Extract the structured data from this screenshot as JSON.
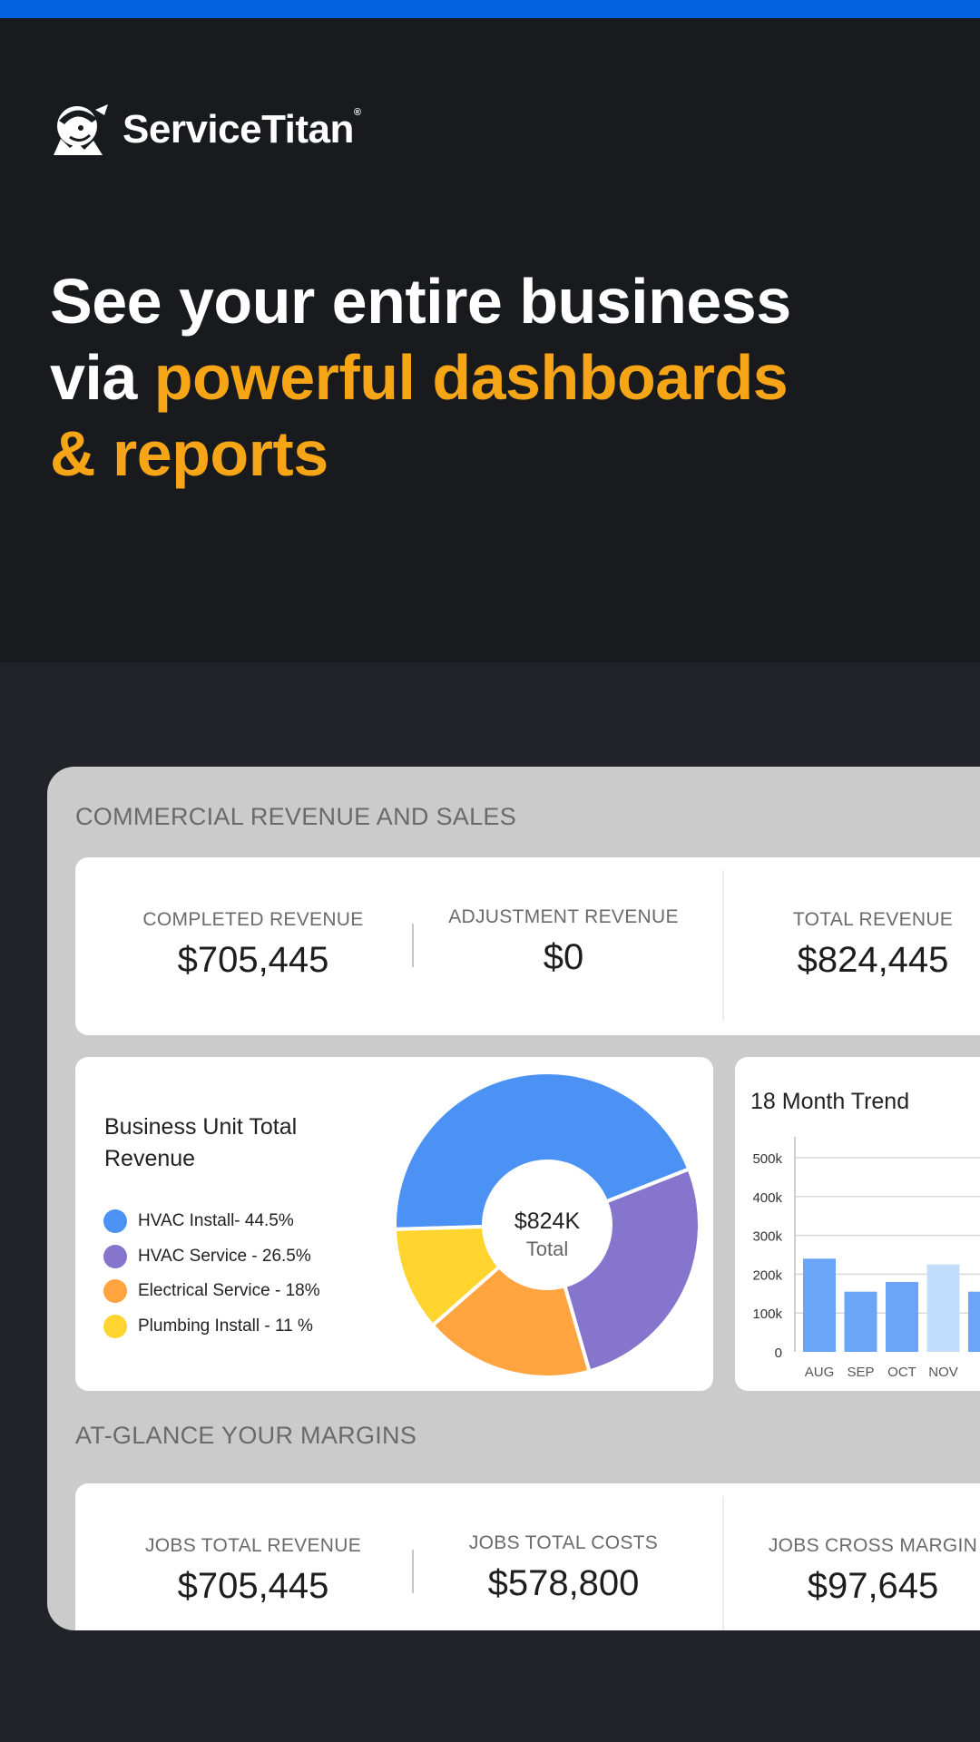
{
  "brand": {
    "name": "ServiceTitan",
    "reg_mark": "®",
    "accent_blue": "#0262e0",
    "accent_orange": "#f5a515"
  },
  "hero": {
    "line1": "See your entire business",
    "line2_prefix": "via ",
    "line2_highlight": "powerful dashboards",
    "line3_highlight": "& reports"
  },
  "revenue_section": {
    "title": "COMMERCIAL REVENUE AND SALES",
    "kpis": [
      {
        "label": "COMPLETED REVENUE",
        "value": "$705,445"
      },
      {
        "label": "ADJUSTMENT REVENUE",
        "value": "$0"
      },
      {
        "label": "TOTAL REVENUE",
        "value": "$824,445"
      }
    ]
  },
  "business_unit": {
    "title": "Business Unit Total Revenue",
    "center_value": "$824K",
    "center_label": "Total",
    "legend": [
      {
        "label": "HVAC Install- 44.5%",
        "color": "#4c92f5"
      },
      {
        "label": "HVAC Service - 26.5%",
        "color": "#8575cc"
      },
      {
        "label": "Electrical Service - 18%",
        "color": "#ffa43f"
      },
      {
        "label": "Plumbing Install - 11 %",
        "color": "#ffd42e"
      }
    ]
  },
  "chart_data": [
    {
      "type": "pie",
      "title": "Business Unit Total Revenue",
      "categories": [
        "HVAC Install",
        "HVAC Service",
        "Electrical Service",
        "Plumbing Install"
      ],
      "values": [
        44.5,
        26.5,
        18,
        11
      ],
      "colors": [
        "#4c92f5",
        "#8575cc",
        "#ffa43f",
        "#ffd42e"
      ],
      "donut": true
    },
    {
      "type": "bar",
      "title": "18 Month Trend",
      "categories": [
        "AUG",
        "SEP",
        "OCT",
        "NOV"
      ],
      "values": [
        240000,
        155000,
        180000,
        225000
      ],
      "highlight_index": 3,
      "bar_color": "#6aa5f7",
      "highlight_color": "#c2dcfb",
      "ylim": [
        0,
        500000
      ],
      "y_ticks": [
        0,
        100000,
        200000,
        300000,
        400000,
        500000
      ],
      "y_tick_labels": [
        "0",
        "100k",
        "200k",
        "300k",
        "400k",
        "500k"
      ],
      "grid": true
    }
  ],
  "margins_section": {
    "title": "AT-GLANCE YOUR MARGINS",
    "kpis": [
      {
        "label": "JOBS TOTAL REVENUE",
        "value": "$705,445"
      },
      {
        "label": "JOBS TOTAL COSTS",
        "value": "$578,800"
      },
      {
        "label": "JOBS CROSS MARGIN",
        "value": "$97,645"
      }
    ]
  }
}
